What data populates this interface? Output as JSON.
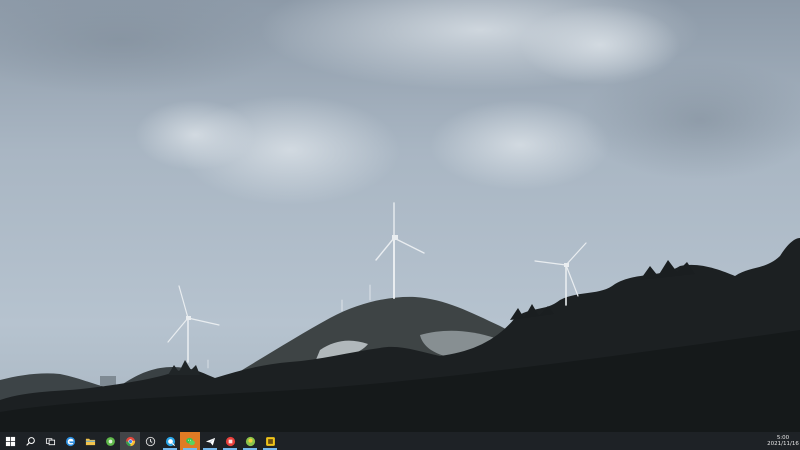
{
  "taskbar": {
    "items": [
      {
        "name": "start-button",
        "icon": "windows-logo-icon",
        "state": "normal"
      },
      {
        "name": "search-button",
        "icon": "search-icon",
        "state": "normal"
      },
      {
        "name": "task-view-button",
        "icon": "task-view-icon",
        "state": "normal"
      },
      {
        "name": "edge-button",
        "icon": "edge-icon",
        "state": "normal"
      },
      {
        "name": "file-explorer-button",
        "icon": "folder-icon",
        "state": "normal"
      },
      {
        "name": "green-app-button",
        "icon": "green-circle-icon",
        "state": "normal"
      },
      {
        "name": "chrome-button",
        "icon": "chrome-icon",
        "state": "active"
      },
      {
        "name": "clock-app-button",
        "icon": "clock-icon",
        "state": "normal"
      },
      {
        "name": "qq-browser-button",
        "icon": "qq-browser-icon",
        "state": "running"
      },
      {
        "name": "wechat-button",
        "icon": "wechat-icon",
        "state": "highlight"
      },
      {
        "name": "feishu-button",
        "icon": "paper-plane-icon",
        "state": "running"
      },
      {
        "name": "red-app-button",
        "icon": "red-circle-icon",
        "state": "running"
      },
      {
        "name": "green-yellow-app-button",
        "icon": "green-yellow-circle-icon",
        "state": "running"
      },
      {
        "name": "yellow-app-button",
        "icon": "yellow-square-icon",
        "state": "running"
      }
    ]
  },
  "clock": {
    "time": "5:00",
    "date": "2021/11/16"
  },
  "colors": {
    "taskbar_bg": "#1e2226",
    "sky": "#b9c6d2",
    "accent_running": "#76b9ed",
    "highlight": "#e07b24"
  }
}
